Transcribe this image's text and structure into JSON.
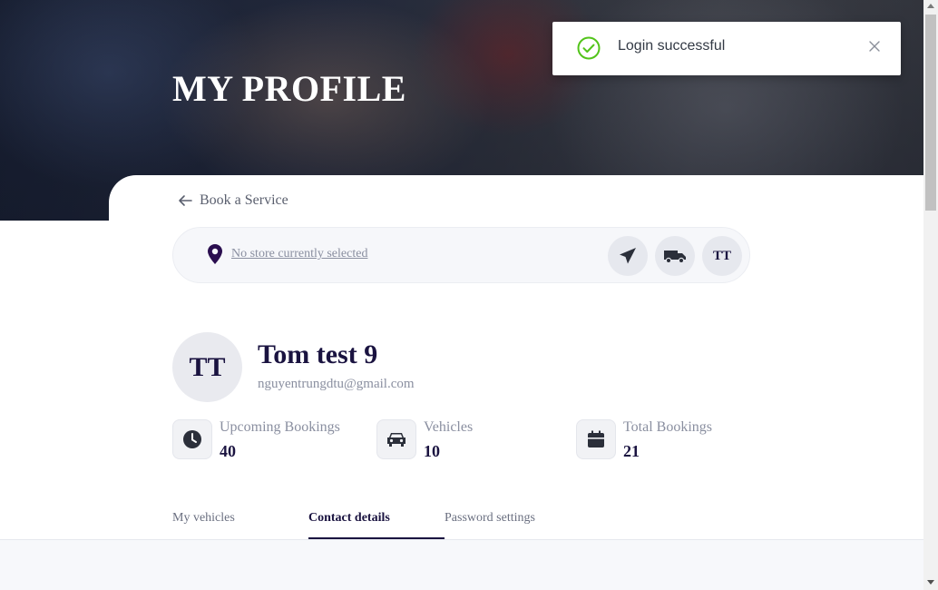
{
  "hero": {
    "title": "MY PROFILE"
  },
  "nav": {
    "back_label": "Book a Service"
  },
  "store": {
    "text": "No store currently selected",
    "user_initials": "TT"
  },
  "profile": {
    "initials": "TT",
    "name": "Tom test 9",
    "email": "nguyentrungdtu@gmail.com"
  },
  "stats": [
    {
      "label": "Upcoming Bookings",
      "value": "40",
      "icon": "clock-icon"
    },
    {
      "label": "Vehicles",
      "value": "10",
      "icon": "car-icon"
    },
    {
      "label": "Total Bookings",
      "value": "21",
      "icon": "calendar-icon"
    }
  ],
  "tabs": [
    {
      "label": "My vehicles",
      "active": false
    },
    {
      "label": "Contact details",
      "active": true
    },
    {
      "label": "Password settings",
      "active": false
    }
  ],
  "toast": {
    "message": "Login successful",
    "status_color": "#52c41a"
  },
  "colors": {
    "primary": "#1a1340",
    "muted": "#8a8fa0",
    "pin": "#2a0e4f"
  }
}
